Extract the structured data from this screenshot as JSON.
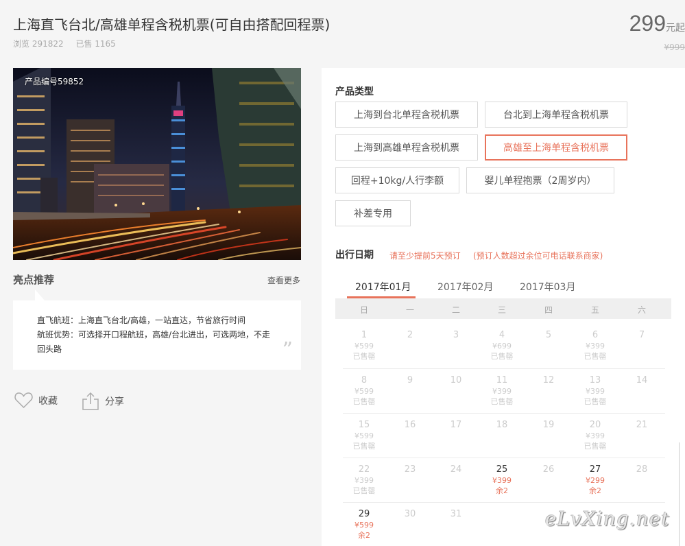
{
  "product": {
    "title": "上海直飞台北/高雄单程含税机票(可自由搭配回程票)",
    "views": "浏览 291822",
    "sold": "已售 1165",
    "price": "299",
    "price_unit": "元起",
    "original_price": "¥999",
    "code": "产品编号59852"
  },
  "highlights": {
    "title": "亮点推荐",
    "more": "查看更多",
    "lines": [
      "直飞航班：上海直飞台北/高雄，一站直达，节省旅行时间",
      "航班优势：可选择开口程航班，高雄/台北进出，可选两地，不走",
      "回头路"
    ],
    "quote": "”"
  },
  "actions": {
    "favorite": "收藏",
    "share": "分享"
  },
  "product_type": {
    "label": "产品类型",
    "options": [
      "上海到台北单程含税机票",
      "台北到上海单程含税机票",
      "上海到高雄单程含税机票",
      "高雄至上海单程含税机票",
      "回程+10kg/人行李额",
      "婴儿单程抱票（2周岁内）",
      "补差专用"
    ],
    "selected": "高雄至上海单程含税机票"
  },
  "travel_date": {
    "label": "出行日期",
    "note1": "请至少提前5天预订",
    "note2": "(预订人数超过余位可电话联系商家)",
    "months": [
      "2017年01月",
      "2017年02月",
      "2017年03月"
    ],
    "active_month": "2017年01月",
    "weekdays": [
      "日",
      "一",
      "二",
      "三",
      "四",
      "五",
      "六"
    ],
    "rows": [
      [
        {
          "d": "1",
          "p": "¥599",
          "s": "已售罄"
        },
        {
          "d": "2"
        },
        {
          "d": "3"
        },
        {
          "d": "4",
          "p": "¥699",
          "s": "已售罄"
        },
        {
          "d": "5"
        },
        {
          "d": "6",
          "p": "¥399",
          "s": "已售罄"
        },
        {
          "d": "7"
        }
      ],
      [
        {
          "d": "8",
          "p": "¥599",
          "s": "已售罄"
        },
        {
          "d": "9"
        },
        {
          "d": "10"
        },
        {
          "d": "11",
          "p": "¥399",
          "s": "已售罄"
        },
        {
          "d": "12"
        },
        {
          "d": "13",
          "p": "¥399",
          "s": "已售罄"
        },
        {
          "d": "14"
        }
      ],
      [
        {
          "d": "15",
          "p": "¥599",
          "s": "已售罄"
        },
        {
          "d": "16"
        },
        {
          "d": "17"
        },
        {
          "d": "18"
        },
        {
          "d": "19"
        },
        {
          "d": "20",
          "p": "¥399",
          "s": "已售罄"
        },
        {
          "d": "21"
        }
      ],
      [
        {
          "d": "22",
          "p": "¥399",
          "s": "已售罄"
        },
        {
          "d": "23"
        },
        {
          "d": "24"
        },
        {
          "d": "25",
          "p": "¥399",
          "s": "余2",
          "on": true
        },
        {
          "d": "26"
        },
        {
          "d": "27",
          "p": "¥299",
          "s": "余2",
          "on": true
        },
        {
          "d": "28"
        }
      ],
      [
        {
          "d": "29",
          "p": "¥599",
          "s": "余2",
          "on": true
        },
        {
          "d": "30"
        },
        {
          "d": "31"
        }
      ]
    ]
  },
  "watermark": "eLvXing.net",
  "colors": {
    "accent": "#e8735b",
    "background": "#f5f5f5"
  }
}
